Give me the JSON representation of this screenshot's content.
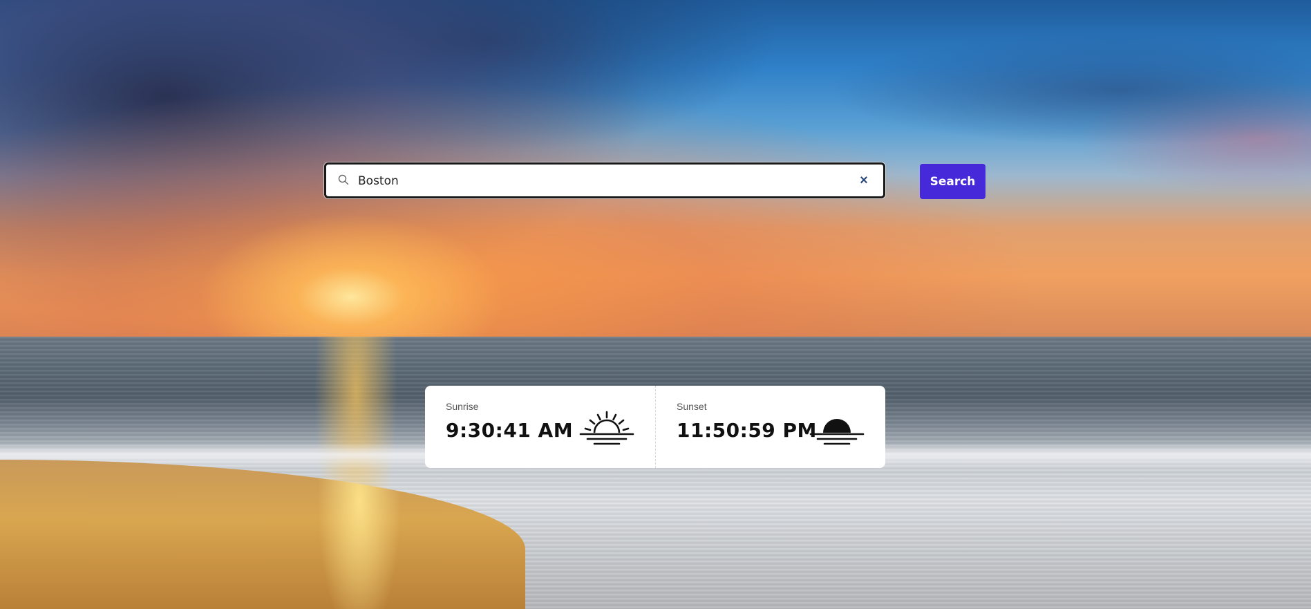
{
  "search": {
    "value": "Boston",
    "clear_symbol": "×",
    "button_label": "Search"
  },
  "sunrise": {
    "label": "Sunrise",
    "time": "9:30:41 AM",
    "icon": "sunrise-icon"
  },
  "sunset": {
    "label": "Sunset",
    "time": "11:50:59 PM",
    "icon": "sunset-icon"
  },
  "colors": {
    "accent": "#4629d8",
    "card_background": "#ffffff",
    "clear_icon": "#2a4a7c"
  }
}
